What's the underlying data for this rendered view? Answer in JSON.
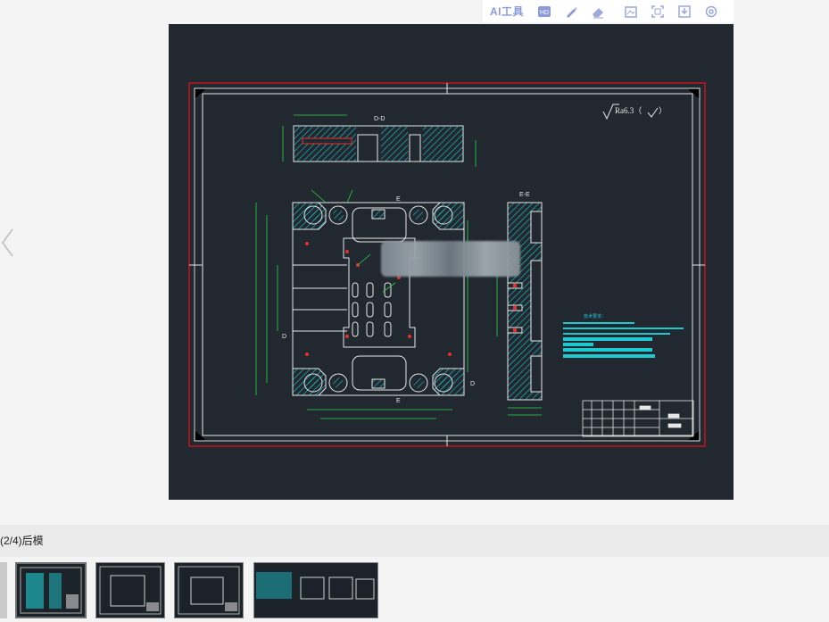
{
  "toolbar": {
    "ai_tools_label": "AI工具",
    "icons": [
      "hd-icon",
      "pen-icon",
      "eraser-icon",
      "crop-icon",
      "fit-icon",
      "download-icon",
      "settings-icon"
    ]
  },
  "drawing": {
    "section_dd_label": "D-D",
    "section_ee_label": "E-E",
    "marker_e_top": "E",
    "marker_e_bottom": "E",
    "marker_d_left": "D",
    "marker_d_right": "D",
    "roughness_symbol": "Ra6.3（",
    "roughness_suffix": "）",
    "notes_title": "技术要求："
  },
  "caption": {
    "text": "(2/4)后模"
  },
  "thumbnails": [
    {
      "name": "thumb-1",
      "selected": true
    },
    {
      "name": "thumb-2",
      "selected": false
    },
    {
      "name": "thumb-3",
      "selected": false
    },
    {
      "name": "thumb-4",
      "selected": false
    }
  ],
  "colors": {
    "drawing_bg": "#212830",
    "border_red": "#c0141e",
    "frame_white": "#e8e8e8",
    "hatch_cyan": "#1fc9d0",
    "dim_green": "#2fd24a",
    "accent_red": "#e0332c"
  }
}
